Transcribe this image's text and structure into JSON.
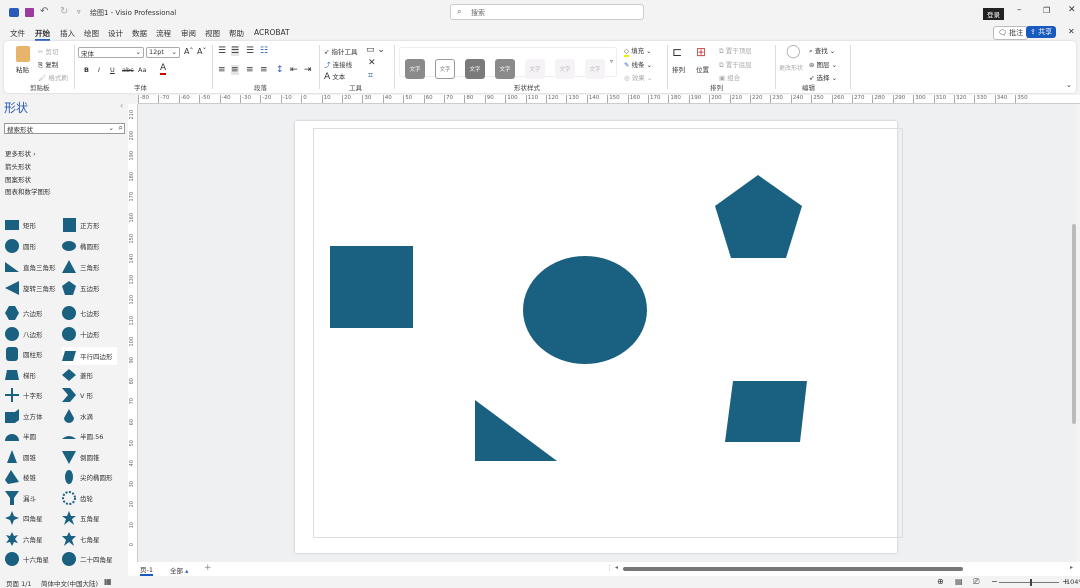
{
  "titlebar": {
    "title": "绘图1  -  Visio Professional",
    "search_placeholder": "搜索",
    "login": "登录",
    "app_icon": "visio-logo",
    "save_icon": "save-icon",
    "undo_icon": "undo-icon",
    "redo_icon": "redo-icon"
  },
  "menu": [
    {
      "label": "文件"
    },
    {
      "label": "开始",
      "active": true
    },
    {
      "label": "插入"
    },
    {
      "label": "绘图"
    },
    {
      "label": "设计"
    },
    {
      "label": "数据"
    },
    {
      "label": "流程"
    },
    {
      "label": "审阅"
    },
    {
      "label": "视图"
    },
    {
      "label": "帮助"
    },
    {
      "label": "ACROBAT"
    }
  ],
  "actions": {
    "comment": "批注",
    "share": "共享"
  },
  "ribbon": {
    "clipboard": {
      "label": "剪贴板",
      "paste": "粘贴",
      "cut": "剪切",
      "copy": "复制",
      "format_painter": "格式刷"
    },
    "font": {
      "label": "字体",
      "font_name": "宋体",
      "font_size": "12pt",
      "bold": "B",
      "italic": "I",
      "underline": "U",
      "strike": "abc",
      "case": "Aa",
      "color": "A",
      "grow": "Aˆ",
      "shrink": "Aˇ"
    },
    "paragraph": {
      "label": "段落"
    },
    "tools": {
      "label": "工具",
      "pointer": "指针工具",
      "connector": "连接线",
      "text": "文本"
    },
    "shape_styles": {
      "label": "形状样式",
      "style_text": "文字",
      "fill": "填充",
      "line": "线条",
      "effects": "效果"
    },
    "arrange": {
      "label": "排列",
      "align": "排列",
      "position": "位置",
      "bring_front": "置于顶层",
      "send_back": "置于底层",
      "group": "组合"
    },
    "editing": {
      "label": "编辑",
      "change_shape": "更改形状",
      "find": "查找",
      "layers": "图层",
      "select": "选择"
    }
  },
  "shapes_panel": {
    "title": "形状",
    "search_placeholder": "搜索形状",
    "more": "更多形状",
    "stencils": [
      "箭头形状",
      "图案形状",
      "图表和数学图形"
    ],
    "items": [
      "矩形",
      "正方形",
      "圆形",
      "椭圆形",
      "直角三角形",
      "三角形",
      "旋转三角形",
      "五边形",
      "六边形",
      "七边形",
      "八边形",
      "十边形",
      "圆柱形",
      "平行四边形",
      "梯形",
      "菱形",
      "十字形",
      "V 形",
      "立方体",
      "水滴",
      "半圆",
      "半圆.56",
      "圆锥",
      "倒圆锥",
      "棱锥",
      "尖的椭圆形",
      "漏斗",
      "齿轮",
      "四角星",
      "五角星",
      "六角星",
      "七角星",
      "十六角星",
      "二十四角星"
    ]
  },
  "ruler": {
    "h_labels": [
      "-80",
      "-70",
      "-60",
      "-50",
      "-40",
      "-30",
      "-20",
      "-10",
      "0",
      "10",
      "20",
      "30",
      "40",
      "50",
      "60",
      "70",
      "80",
      "90",
      "100",
      "110",
      "120",
      "130",
      "140",
      "150",
      "160",
      "170",
      "180",
      "190",
      "200",
      "210",
      "220",
      "230",
      "240",
      "250",
      "260",
      "270",
      "280",
      "290",
      "300",
      "310",
      "320",
      "330",
      "340",
      "350"
    ],
    "v_labels": [
      "210",
      "200",
      "190",
      "180",
      "170",
      "160",
      "150",
      "140",
      "130",
      "120",
      "110",
      "100",
      "90",
      "80",
      "70",
      "60",
      "50",
      "40",
      "30",
      "20",
      "10",
      "0"
    ]
  },
  "canvas": {
    "shape_color": "#1a6080",
    "shapes": [
      "square",
      "ellipse",
      "pentagon",
      "right-triangle",
      "parallelogram"
    ]
  },
  "tabs": {
    "page": "页-1",
    "all": "全部",
    "add": "+"
  },
  "status": {
    "page": "页面 1/1",
    "language": "简体中文(中国大陆)",
    "zoom": "104%",
    "zoom_fraction": 0.52
  }
}
